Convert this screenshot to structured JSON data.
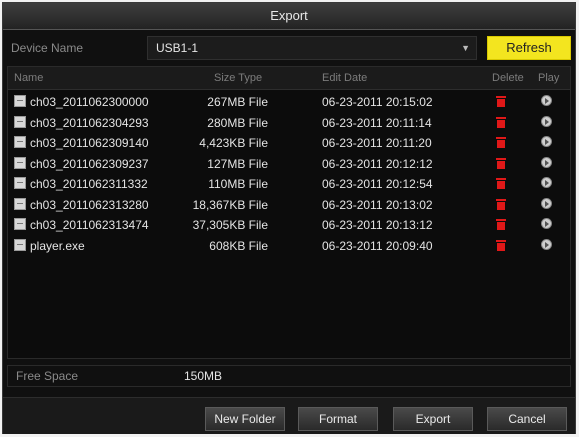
{
  "window": {
    "title": "Export"
  },
  "device": {
    "label": "Device Name",
    "value": "USB1-1",
    "refresh_label": "Refresh"
  },
  "table": {
    "headers": {
      "name": "Name",
      "size_type": "Size Type",
      "edit_date": "Edit Date",
      "delete": "Delete",
      "play": "Play"
    },
    "rows": [
      {
        "name": "ch03_2011062300000",
        "size": "267MB File",
        "date": "06-23-2011 20:15:02"
      },
      {
        "name": "ch03_2011062304293",
        "size": "280MB File",
        "date": "06-23-2011 20:11:14"
      },
      {
        "name": "ch03_2011062309140",
        "size": "4,423KB File",
        "date": "06-23-2011 20:11:20"
      },
      {
        "name": "ch03_2011062309237",
        "size": "127MB File",
        "date": "06-23-2011 20:12:12"
      },
      {
        "name": "ch03_2011062311332",
        "size": "110MB File",
        "date": "06-23-2011 20:12:54"
      },
      {
        "name": "ch03_2011062313280",
        "size": "18,367KB File",
        "date": "06-23-2011 20:13:02"
      },
      {
        "name": "ch03_2011062313474",
        "size": "37,305KB File",
        "date": "06-23-2011 20:13:12"
      },
      {
        "name": "player.exe",
        "size": "608KB File",
        "date": "06-23-2011 20:09:40"
      }
    ]
  },
  "free_space": {
    "label": "Free Space",
    "value": "150MB"
  },
  "buttons": {
    "new_folder": "New Folder",
    "format": "Format",
    "export": "Export",
    "cancel": "Cancel"
  },
  "colors": {
    "refresh_bg": "#f3e51f",
    "delete_icon": "#e01818"
  }
}
